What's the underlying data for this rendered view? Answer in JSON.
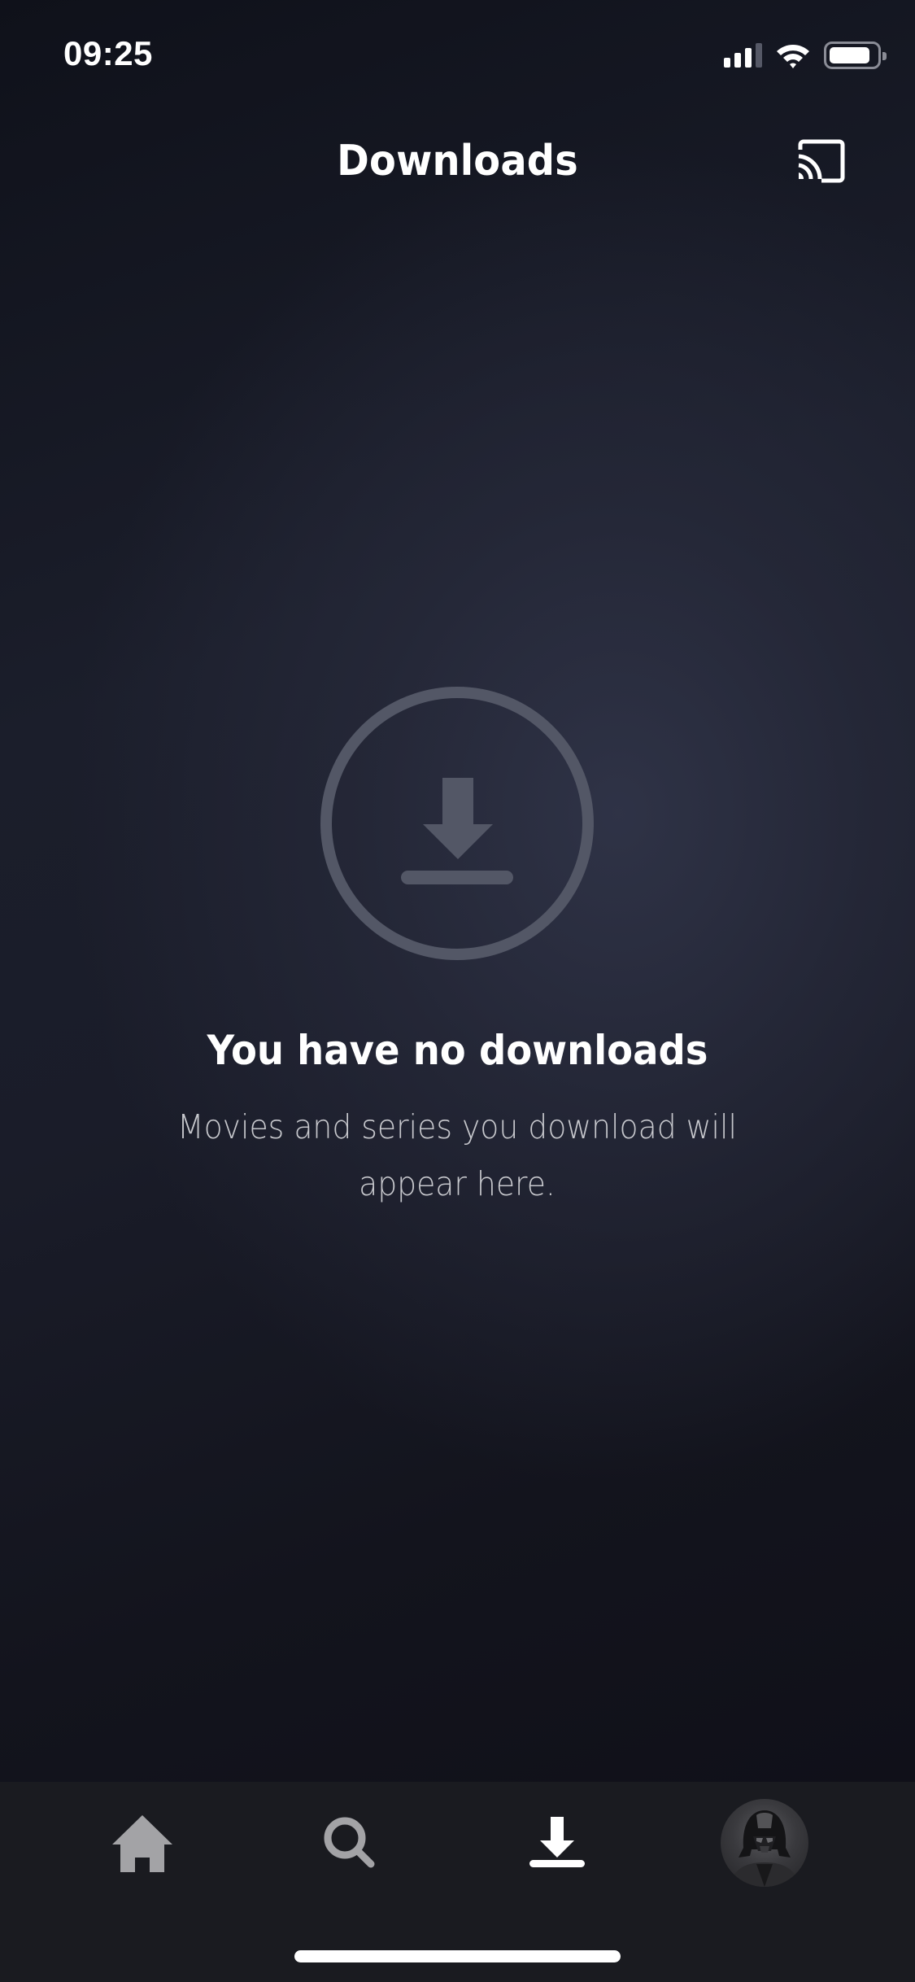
{
  "status_bar": {
    "time": "09:25",
    "signal_bars_active": 3,
    "signal_bars_total": 4,
    "wifi": "connected",
    "battery_level_percent": 85
  },
  "header": {
    "title": "Downloads",
    "cast_icon": "cast-icon"
  },
  "empty_state": {
    "icon": "download-circle-icon",
    "title": "You have no downloads",
    "description": "Movies and series you download will appear here."
  },
  "tab_bar": {
    "items": [
      {
        "name": "home",
        "icon": "home-icon",
        "active": false
      },
      {
        "name": "search",
        "icon": "search-icon",
        "active": false
      },
      {
        "name": "downloads",
        "icon": "download-icon",
        "active": true
      },
      {
        "name": "profile",
        "icon": "avatar",
        "active": false
      }
    ]
  },
  "colors": {
    "background_dark": "#11141d",
    "background_light": "#2b2e40",
    "empty_icon": "#535766",
    "tab_bar_bg": "#1a1b20",
    "tab_inactive": "#a3a3a6",
    "tab_active": "#ffffff",
    "description_text": "#c7c8cd"
  }
}
